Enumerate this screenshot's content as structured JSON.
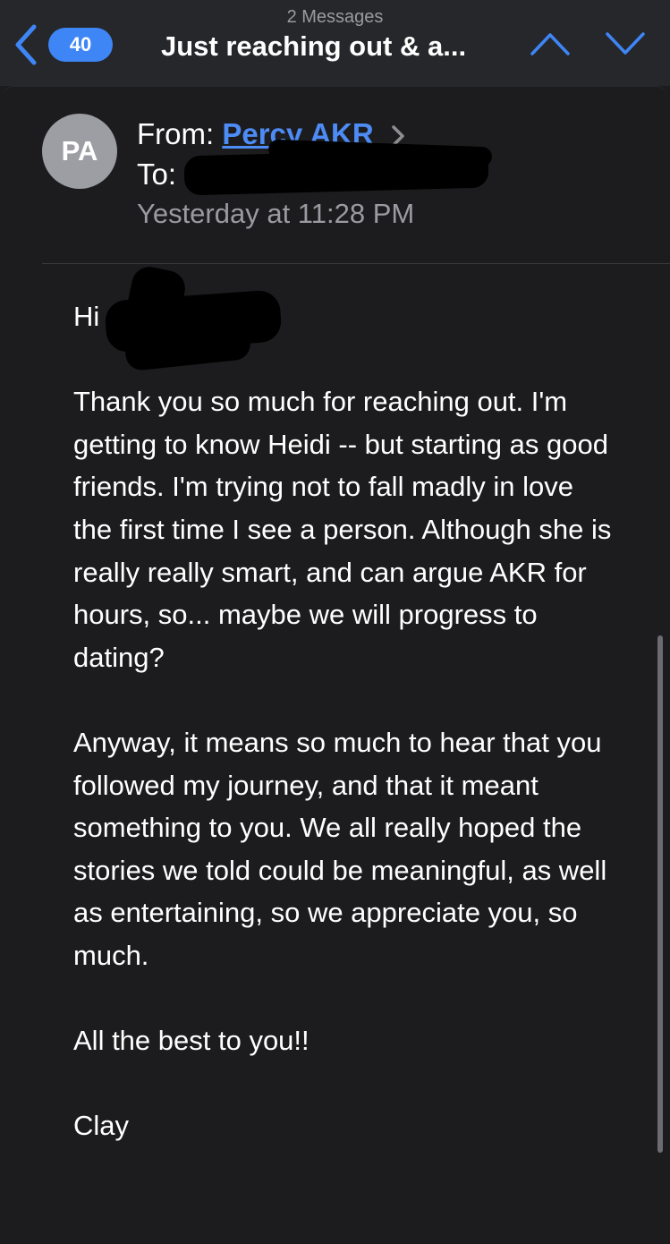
{
  "nav": {
    "message_count": "2 Messages",
    "title": "Just reaching out & a...",
    "badge": "40",
    "accent": "#3e86f6"
  },
  "message": {
    "avatar_initials": "PA",
    "from_label": "From:",
    "sender": "Percy AKR",
    "to_label": "To:",
    "recipient": "",
    "date": "Yesterday at 11:28 PM",
    "greeting": "Hi",
    "paragraphs": [
      "Thank you so much for reaching out. I'm getting to know Heidi -- but starting as good friends. I'm trying not to fall madly in love the first time I see a person. Although she is really really smart, and can argue AKR for hours, so... maybe we will progress to dating?",
      "Anyway, it means so much to hear that you followed my journey, and that it meant something to you. We all really hoped the stories we told could be meaningful, as well as entertaining, so we appreciate you, so much.",
      "All the best to you!!",
      "Clay"
    ]
  },
  "icons": {
    "back": "chevron-left-icon",
    "up": "chevron-up-icon",
    "down": "chevron-down-icon",
    "sender_disclosure": "chevron-right-icon"
  }
}
